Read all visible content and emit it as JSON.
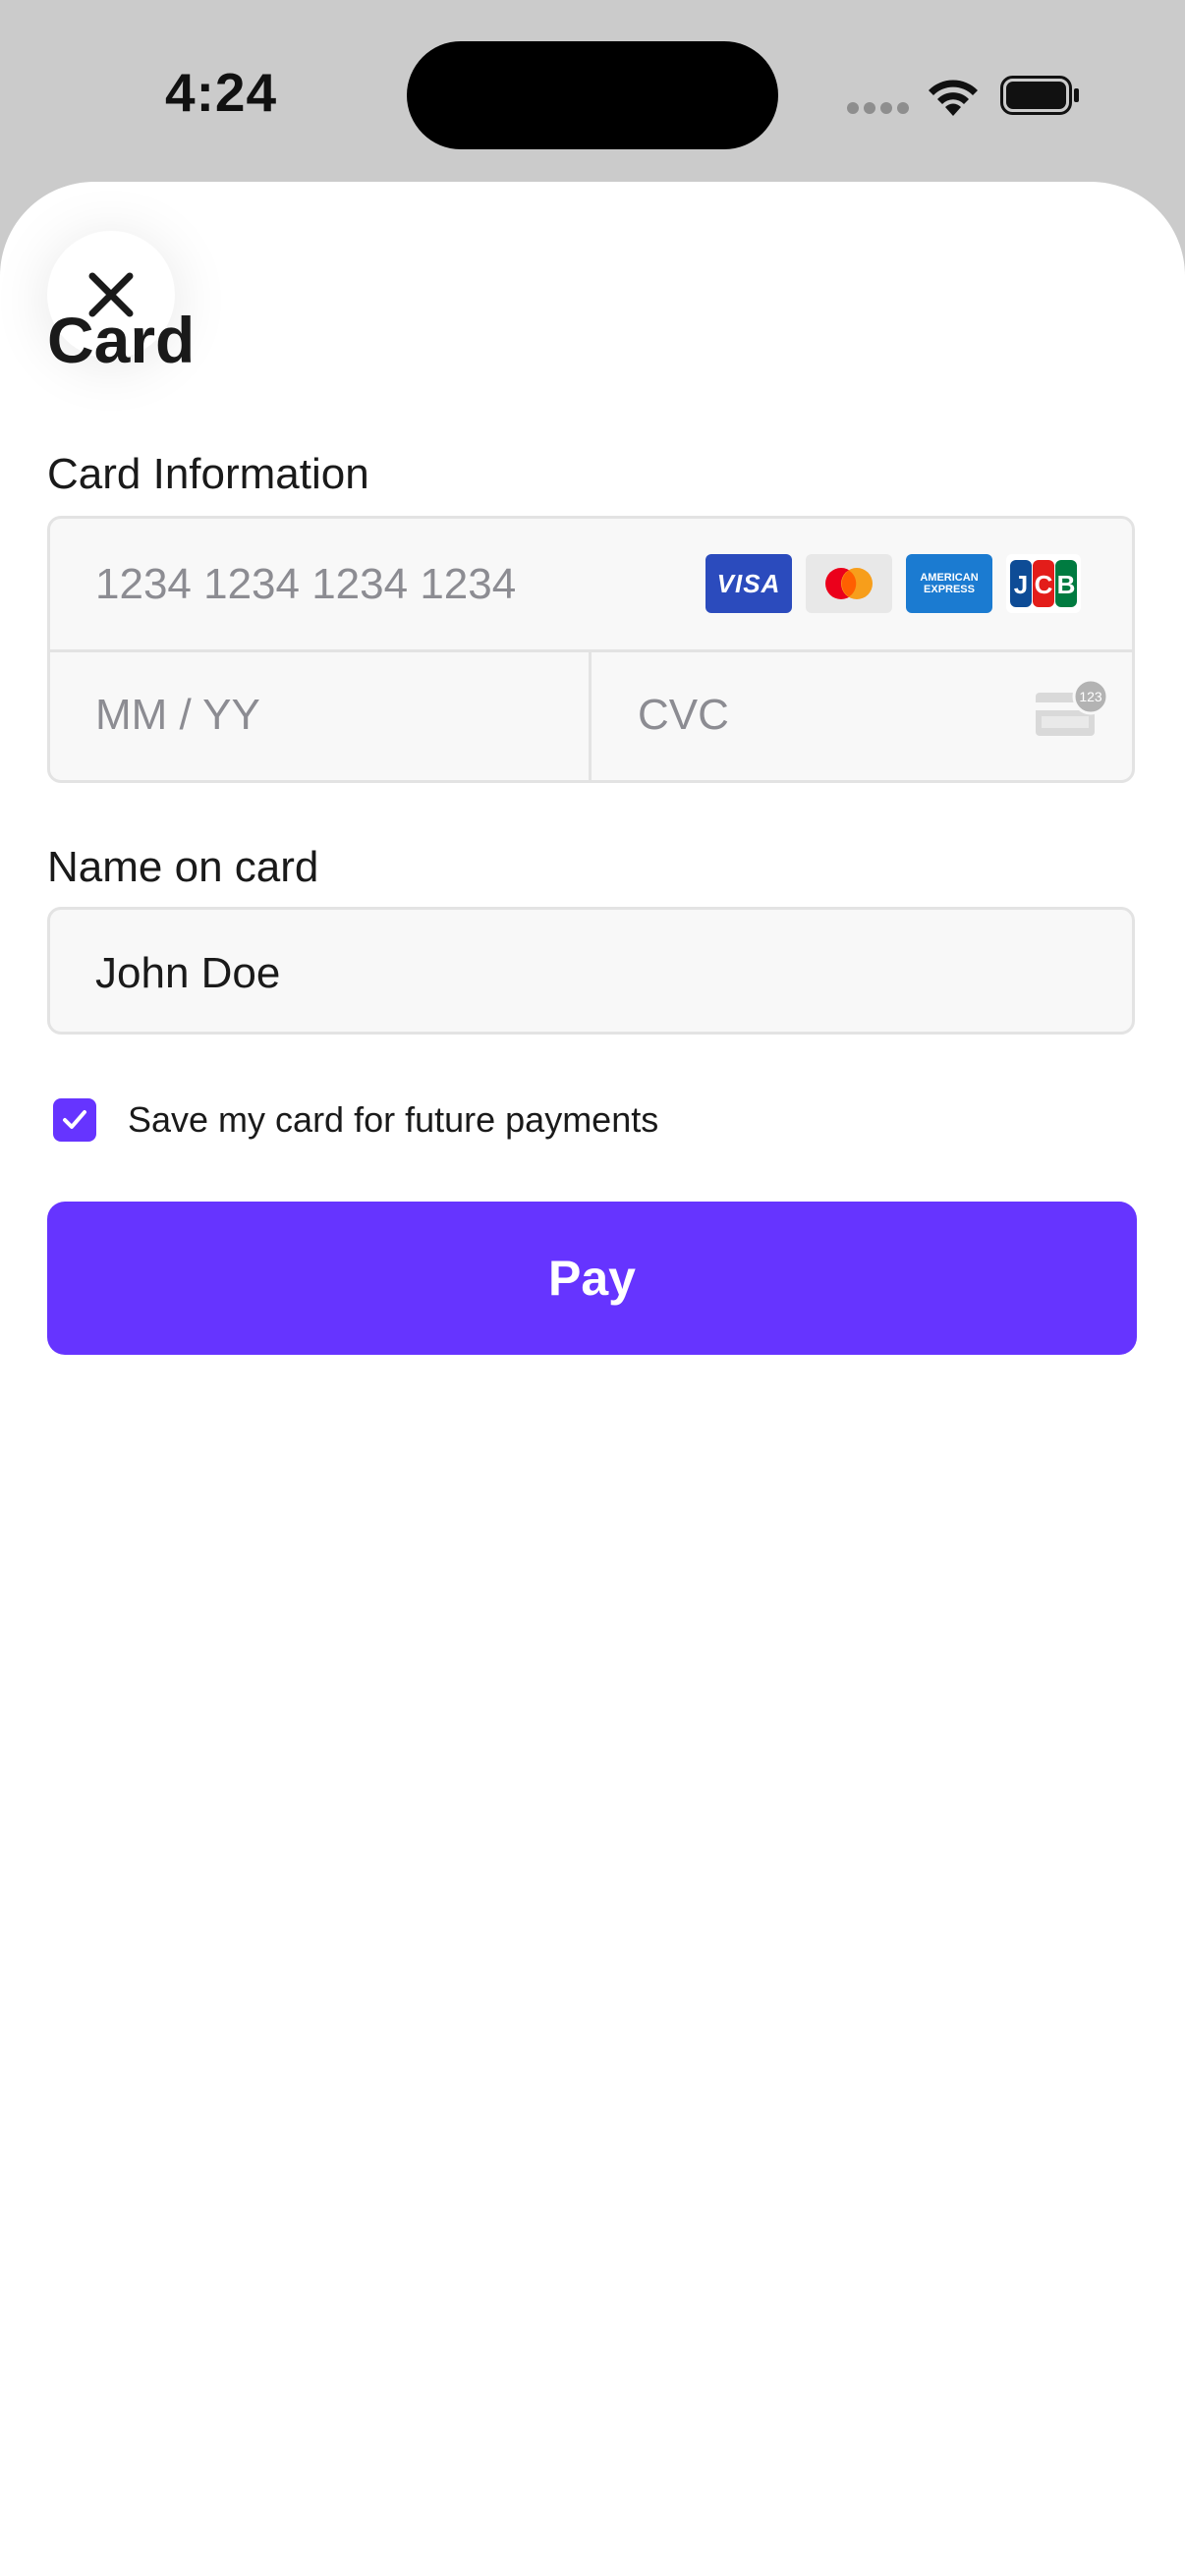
{
  "status_bar": {
    "time": "4:24"
  },
  "sheet": {
    "title": "Card",
    "card_information_label": "Card Information",
    "card_number_placeholder": "1234 1234 1234 1234",
    "expiry_placeholder": "MM / YY",
    "cvc_placeholder": "CVC",
    "cvc_icon_text": "123",
    "brands": [
      {
        "name": "visa-icon",
        "text": "VISA"
      },
      {
        "name": "mastercard-icon"
      },
      {
        "name": "amex-icon",
        "text_top": "AMERICAN",
        "text_bottom": "EXPRESS"
      },
      {
        "name": "jcb-icon",
        "text": "JCB"
      }
    ],
    "name_label": "Name on card",
    "name_value": "John Doe",
    "save_card_label": "Save my card for future payments",
    "save_card_checked": true,
    "pay_label": "Pay"
  },
  "colors": {
    "accent": "#6634ff",
    "status_background": "#cbcbcb",
    "field_background": "#f8f8f8",
    "field_border": "#e3e3e3",
    "placeholder": "#8c8c92"
  }
}
